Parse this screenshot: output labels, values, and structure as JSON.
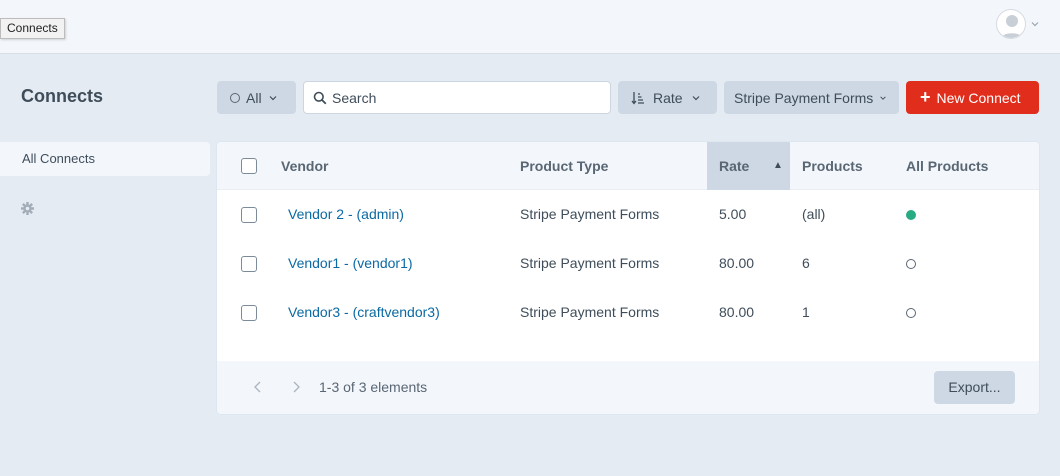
{
  "tooltip": "Connects",
  "account": {
    "avatar_icon": "user-avatar-icon"
  },
  "page": {
    "title": "Connects"
  },
  "toolbar": {
    "status_label": "All",
    "search_placeholder": "Search",
    "sort_label": "Rate",
    "site_label": "Stripe Payment Forms",
    "new_label": "New Connect"
  },
  "sidebar": {
    "items": [
      {
        "label": "All Connects",
        "active": true
      }
    ],
    "settings_icon": "gear-icon"
  },
  "table": {
    "columns": {
      "vendor": "Vendor",
      "product_type": "Product Type",
      "rate": "Rate",
      "products": "Products",
      "all_products": "All Products"
    },
    "sort": {
      "column": "rate",
      "direction": "ascending"
    },
    "rows": [
      {
        "vendor": "Vendor 2 - (admin)",
        "product_type": "Stripe Payment Forms",
        "rate": "5.00",
        "products": "(all)",
        "all_products": true
      },
      {
        "vendor": "Vendor1 - (vendor1)",
        "product_type": "Stripe Payment Forms",
        "rate": "80.00",
        "products": "6",
        "all_products": false
      },
      {
        "vendor": "Vendor3 - (craftvendor3)",
        "product_type": "Stripe Payment Forms",
        "rate": "80.00",
        "products": "1",
        "all_products": false
      }
    ]
  },
  "footer": {
    "count_text": "1-3 of 3 elements",
    "export_label": "Export..."
  },
  "colors": {
    "accent_red": "#e12d1b",
    "link_blue": "#0b69a3",
    "status_green": "#27ab83"
  }
}
